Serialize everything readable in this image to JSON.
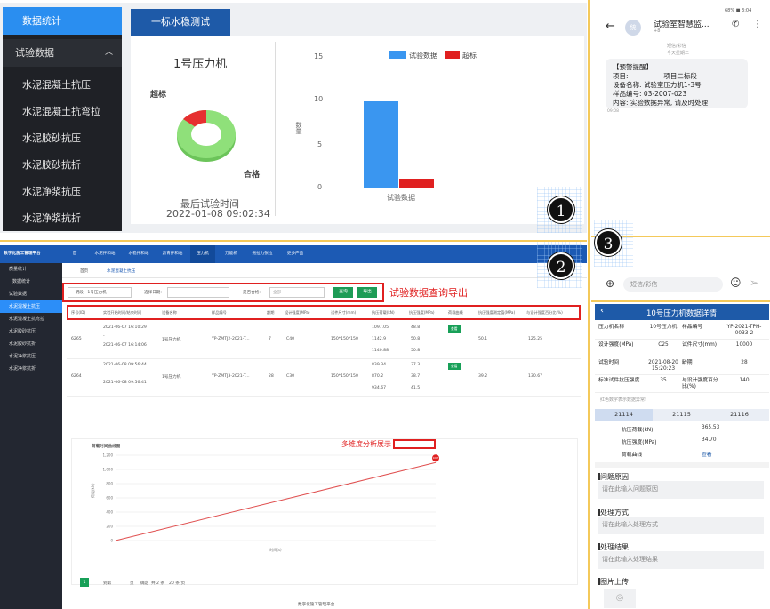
{
  "panel1": {
    "sidebar": {
      "header": "数据统计",
      "group": "试验数据",
      "items": [
        "水泥混凝土抗压",
        "水泥混凝土抗弯拉",
        "水泥胶砂抗压",
        "水泥胶砂抗折",
        "水泥净浆抗压",
        "水泥净浆抗折"
      ]
    },
    "tab": "一标水稳测试",
    "donut": {
      "title": "1号压力机",
      "label_exceed": "超标",
      "label_pass": "合格",
      "last_label": "最后试验时间",
      "last_time": "2022-01-08 09:02:34",
      "colors": {
        "pass": "#8fe07a",
        "exceed": "#e63030"
      }
    },
    "bar_chart": {
      "legend_data": "试验数据",
      "legend_exceed": "超标",
      "ylabel": "数量",
      "xlabel": "试验数据",
      "ticks": [
        "15",
        "10",
        "5",
        "0"
      ],
      "colors": {
        "data": "#3a96f0",
        "exceed": "#e02020"
      }
    }
  },
  "panel2": {
    "app_title": "数字化施工管理平台",
    "nav": [
      "首",
      "水泥拌和站",
      "水稳拌和站",
      "沥青拌和站",
      "压力机",
      "万能机",
      "拖拉力张拉",
      "更多产品"
    ],
    "sidebar": {
      "items": [
        "质量统计",
        "数据统计",
        "试验数据",
        "水泥混凝土抗压",
        "水泥混凝土抗弯拉",
        "水泥胶砂抗压",
        "水泥胶砂抗折",
        "水泥净浆抗压",
        "水泥净浆抗折"
      ]
    },
    "breadcrumb": [
      "首页",
      "水泥混凝土抗压"
    ],
    "filter": {
      "device": "一明段 - 1号压力机",
      "date_label": "选择日期:",
      "result_label": "是否合格:",
      "result_value": "全部",
      "query": "查询",
      "export": "导出"
    },
    "annotation_query": "试验数据查询导出",
    "table": {
      "headers": [
        "序号(ID)",
        "实验开始时间/结束时间",
        "设备名称",
        "样品编号",
        "龄期",
        "设计强度(MPa)",
        "试件尺寸(mm)",
        "抗压荷载(kN)",
        "抗压强度(MPa)",
        "荷载曲线",
        "抗压强度测定值(MPa)",
        "与设计强度百分比(%)"
      ],
      "rows": [
        {
          "id": "6265",
          "time": [
            "2021-06-07 16:10:29",
            "-",
            "2021-06-07 16:14:06"
          ],
          "device": "1号压力机",
          "sample": "YP-ZMTJ2-2021-T...",
          "age": "7",
          "design": "C40",
          "size": "150*150*150",
          "loads": [
            "1097.05",
            "1142.9",
            "1140.88"
          ],
          "strengths": [
            "48.8",
            "50.8",
            "50.8"
          ],
          "curve": "查看",
          "measured": "50.1",
          "pct": "125.25"
        },
        {
          "id": "6264",
          "time": [
            "2021-06-08 09:56:44",
            "-",
            "2021-06-08 09:56:41"
          ],
          "device": "1号压力机",
          "sample": "YP-ZMTJ3-2021-T...",
          "age": "28",
          "design": "C30",
          "size": "150*150*150",
          "loads": [
            "839.34",
            "870.2",
            "934.67"
          ],
          "strengths": [
            "37.3",
            "38.7",
            "41.5"
          ],
          "curve": "查看",
          "measured": "39.2",
          "pct": "130.67"
        }
      ]
    },
    "chart_title": "荷载时间曲线图",
    "annotation_chart": "多维度分析展示",
    "chart_data": {
      "type": "line",
      "ylim": [
        0,
        1200
      ],
      "yticks": [
        "1,200",
        "1,000",
        "800",
        "600",
        "400",
        "200",
        "0"
      ],
      "xlabel": "时间(s)",
      "ylabel": "荷载(kN)",
      "points": [
        [
          0,
          0
        ],
        [
          100,
          1097
        ]
      ],
      "peak_label": "1097",
      "color": "#e05050"
    },
    "pager": {
      "page": "1",
      "goto": "到第",
      "page_unit": "页",
      "confirm": "确定",
      "total": "共 2 条",
      "per_page": "20 条/页"
    },
    "footer": "数字化施工管理平台"
  },
  "panel3": {
    "status": "68% ■ 3:04",
    "sender": "试验室智慧监...",
    "sender_sub": "+8",
    "avatar": "统",
    "msg_meta": [
      "短信/彩信",
      "今天星期二"
    ],
    "msg": [
      "【预警提醒】",
      "项目: 　　　　　项目二标段",
      "设备名称: 试验室压力机1-3号",
      "样品编号: 03-2007-023",
      "内容: 实验数据异常, 请及时处理"
    ],
    "msg_time": "09:08",
    "input_placeholder": "短信/彩信",
    "detail_title": "10号压力机数据详情",
    "detail_rows": [
      [
        "压力机名称",
        "10号压力机",
        "样品编号",
        "YP-2021-TPH-0033-2"
      ],
      [
        "设计强度(MPa)",
        "C25",
        "试件尺寸(mm)",
        "10000"
      ],
      [
        "试验时间",
        "2021-08-20 15:20:23",
        "龄期",
        "28"
      ],
      [
        "标准试件抗压强度",
        "35",
        "与设计强度百分比(%)",
        "140"
      ]
    ],
    "note": "红色数字表示数据异常!",
    "tabs": [
      "21114",
      "21115",
      "21116"
    ],
    "sub_rows": [
      [
        "抗压荷载(kN)",
        "365.53"
      ],
      [
        "抗压强度(MPa)",
        "34.70"
      ],
      [
        "荷载曲线",
        "查看"
      ]
    ],
    "sections": [
      {
        "title": "问题原因",
        "placeholder": "请在此输入问题原因"
      },
      {
        "title": "处理方式",
        "placeholder": "请在此输入处理方式"
      },
      {
        "title": "处理结果",
        "placeholder": "请在此输入处理结果"
      }
    ],
    "upload": "图片上传"
  },
  "markers": [
    "1",
    "2",
    "3"
  ]
}
